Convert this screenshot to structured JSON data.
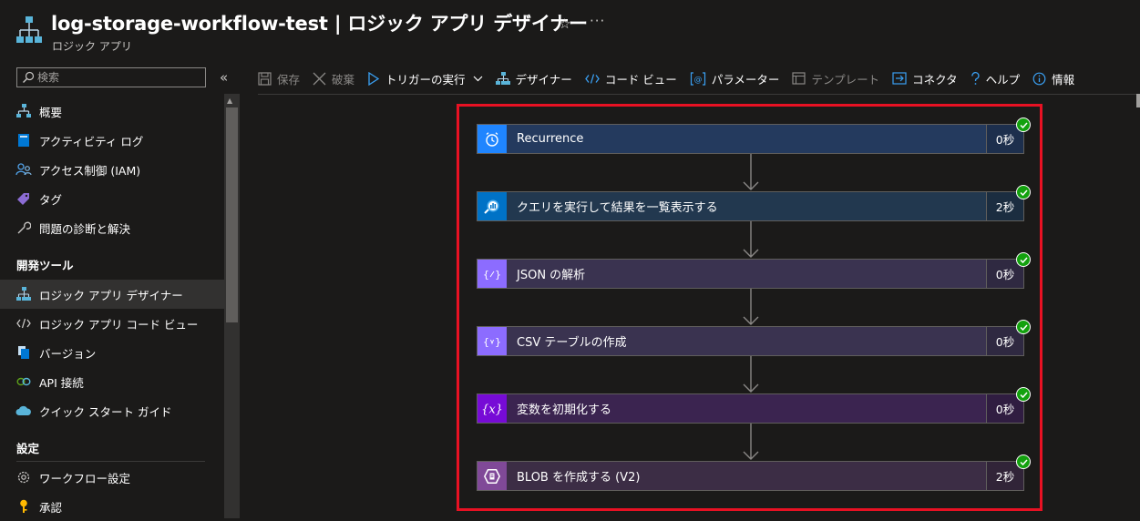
{
  "header": {
    "title": "log-storage-workflow-test | ロジック アプリ デザイナー",
    "subtitle": "ロジック アプリ",
    "star_icon": "star-icon",
    "more_label": "···"
  },
  "sidebar": {
    "search": {
      "placeholder": "検索",
      "value": ""
    },
    "collapse_label": "«",
    "items_top": [
      {
        "label": "概要",
        "icon": "overview-icon"
      },
      {
        "label": "アクティビティ ログ",
        "icon": "activity-log-icon"
      },
      {
        "label": "アクセス制御 (IAM)",
        "icon": "iam-icon"
      },
      {
        "label": "タグ",
        "icon": "tag-icon"
      },
      {
        "label": "問題の診断と解決",
        "icon": "wrench-icon"
      }
    ],
    "section_dev": "開発ツール",
    "items_dev": [
      {
        "label": "ロジック アプリ デザイナー",
        "icon": "designer-icon",
        "selected": true
      },
      {
        "label": "ロジック アプリ コード ビュー",
        "icon": "code-icon"
      },
      {
        "label": "バージョン",
        "icon": "versions-icon"
      },
      {
        "label": "API 接続",
        "icon": "api-connection-icon"
      },
      {
        "label": "クイック スタート ガイド",
        "icon": "cloud-icon"
      }
    ],
    "section_settings": "設定",
    "items_settings": [
      {
        "label": "ワークフロー設定",
        "icon": "gear-icon"
      },
      {
        "label": "承認",
        "icon": "key-icon"
      }
    ]
  },
  "toolbar": {
    "save": "保存",
    "discard": "破棄",
    "run_trigger": "トリガーの実行",
    "designer": "デザイナー",
    "code_view": "コード ビュー",
    "parameters": "パラメーター",
    "templates": "テンプレート",
    "connectors": "コネクタ",
    "help": "ヘルプ",
    "info": "情報"
  },
  "steps": [
    {
      "title": "Recurrence",
      "duration": "0秒",
      "color": "#1f85ff",
      "bar": "#243a5e",
      "icon": "clock-icon",
      "status": "succeeded"
    },
    {
      "title": "クエリを実行して結果を一覧表示する",
      "duration": "2秒",
      "color": "#0072c6",
      "bar": "#22384f",
      "icon": "log-analytics-icon",
      "status": "succeeded"
    },
    {
      "title": "JSON の解析",
      "duration": "0秒",
      "color": "#8c6cff",
      "bar": "#3a3350",
      "icon": "data-operations-icon",
      "status": "succeeded"
    },
    {
      "title": "CSV テーブルの作成",
      "duration": "0秒",
      "color": "#8c6cff",
      "bar": "#3a3350",
      "icon": "data-operations-icon",
      "status": "succeeded"
    },
    {
      "title": "変数を初期化する",
      "duration": "0秒",
      "color": "#770bd6",
      "bar": "#3b2450",
      "icon": "variable-icon",
      "status": "succeeded"
    },
    {
      "title": "BLOB を作成する (V2)",
      "duration": "2秒",
      "color": "#804998",
      "bar": "#3c2d45",
      "icon": "blob-storage-icon",
      "status": "succeeded"
    }
  ],
  "colors": {
    "highlight_frame": "#e81123",
    "success": "#13a10e",
    "background": "#1b1a19"
  }
}
